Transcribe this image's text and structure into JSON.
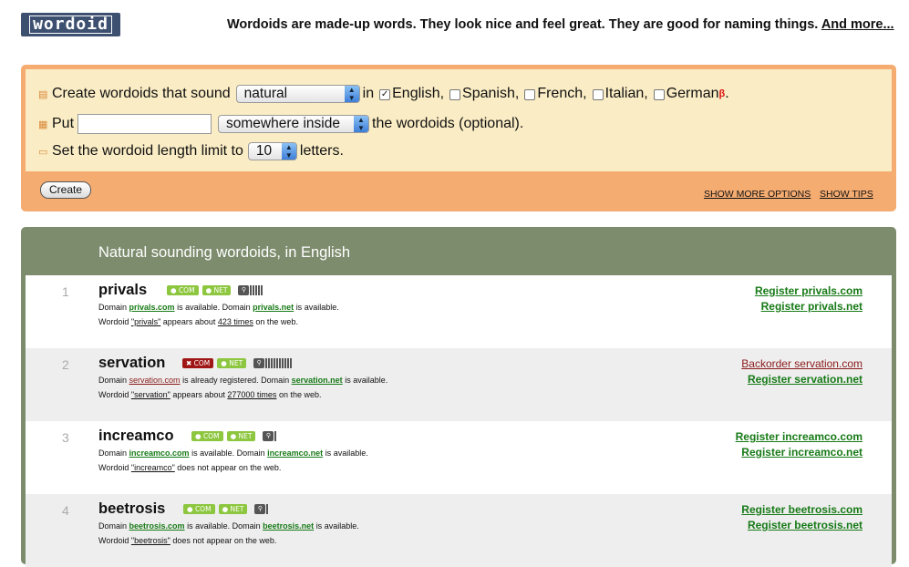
{
  "header": {
    "logo_text": "wordoid",
    "tagline": "Wordoids are made-up words. They look nice and feel great. They are good for naming things.",
    "more_link": "And more..."
  },
  "form": {
    "row1": {
      "label": "Create wordoids that sound",
      "select_value": "natural",
      "in_text": "in",
      "languages": [
        {
          "label": "English,",
          "checked": true
        },
        {
          "label": "Spanish,",
          "checked": false
        },
        {
          "label": "French,",
          "checked": false
        },
        {
          "label": "Italian,",
          "checked": false
        },
        {
          "label": "German",
          "checked": false
        }
      ],
      "beta": "β",
      "end": "."
    },
    "row2": {
      "label": "Put",
      "input_value": "",
      "select_value": "somewhere inside",
      "suffix": "the wordoids (optional)."
    },
    "row3": {
      "label": "Set the wordoid length limit to",
      "select_value": "10",
      "suffix": "letters."
    },
    "create_button": "Create",
    "show_more_options": "SHOW MORE OPTIONS",
    "show_tips": "SHOW TIPS"
  },
  "results": {
    "title": "Natural sounding wordoids, in English",
    "items": [
      {
        "num": "1",
        "word": "privals",
        "com_label": "COM",
        "net_label": "NET",
        "com_ok": true,
        "net_ok": true,
        "popularity_bars": 5,
        "line1": {
          "pre": "Domain",
          "com": "privals.com",
          "com_status": "is available. Domain",
          "net": "privals.net",
          "net_status": "is available."
        },
        "line2": {
          "pre": "Wordoid",
          "word": "\"privals\"",
          "mid": "appears about",
          "count": "423 times",
          "post": "on the web."
        },
        "reg1": "Register privals.com",
        "reg2": "Register privals.net"
      },
      {
        "num": "2",
        "word": "servation",
        "com_label": "COM",
        "net_label": "NET",
        "com_ok": false,
        "net_ok": true,
        "popularity_bars": 10,
        "line1": {
          "pre": "Domain",
          "com": "servation.com",
          "com_status": "is already registered. Domain",
          "net": "servation.net",
          "net_status": "is available."
        },
        "line2": {
          "pre": "Wordoid",
          "word": "\"servation\"",
          "mid": "appears about",
          "count": "277000 times",
          "post": "on the web."
        },
        "reg1": "Backorder servation.com",
        "reg2": "Register servation.net"
      },
      {
        "num": "3",
        "word": "increamco",
        "com_label": "COM",
        "net_label": "NET",
        "com_ok": true,
        "net_ok": true,
        "popularity_bars": 1,
        "line1": {
          "pre": "Domain",
          "com": "increamco.com",
          "com_status": "is available. Domain",
          "net": "increamco.net",
          "net_status": "is available."
        },
        "line2": {
          "pre": "Wordoid",
          "word": "\"increamco\"",
          "mid": "does not appear on the web.",
          "count": "",
          "post": ""
        },
        "reg1": "Register increamco.com",
        "reg2": "Register increamco.net"
      },
      {
        "num": "4",
        "word": "beetrosis",
        "com_label": "COM",
        "net_label": "NET",
        "com_ok": true,
        "net_ok": true,
        "popularity_bars": 1,
        "line1": {
          "pre": "Domain",
          "com": "beetrosis.com",
          "com_status": "is available. Domain",
          "net": "beetrosis.net",
          "net_status": "is available."
        },
        "line2": {
          "pre": "Wordoid",
          "word": "\"beetrosis\"",
          "mid": "does not appear on the web.",
          "count": "",
          "post": ""
        },
        "reg1": "Register beetrosis.com",
        "reg2": "Register beetrosis.net"
      }
    ]
  }
}
